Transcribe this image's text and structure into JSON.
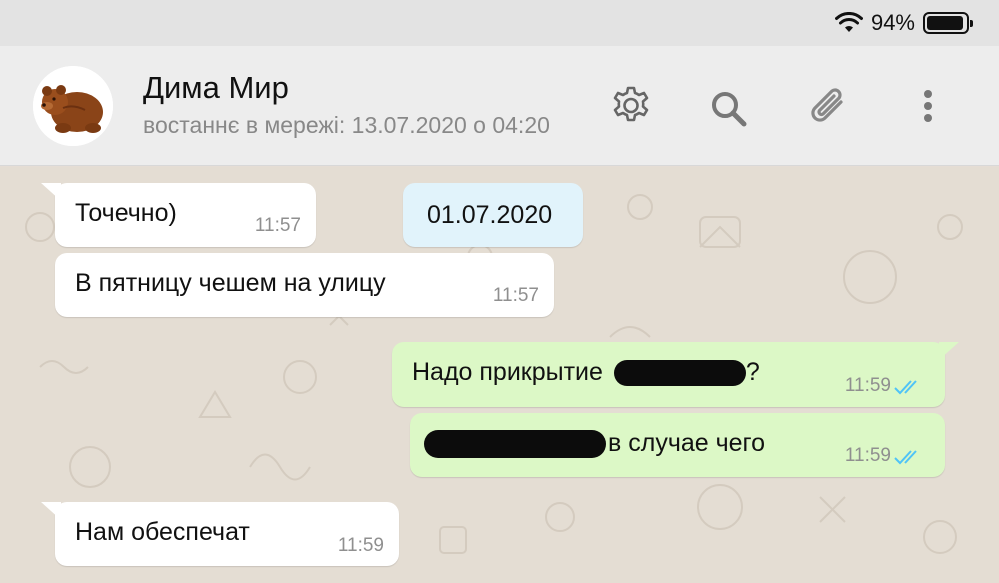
{
  "status_bar": {
    "battery": "94%",
    "battery_level": 0.94
  },
  "header": {
    "contact_name": "Дима Мир",
    "contact_status": "востаннє в мережі: 13.07.2020 о 04:20",
    "icons": [
      "settings-gear-icon",
      "search-icon",
      "paperclip-icon",
      "more-vertical-icon"
    ]
  },
  "colors": {
    "incoming_bubble": "#ffffff",
    "outgoing_bubble": "#dcf8c6",
    "date_badge": "#e1f3fb",
    "chat_background": "#e4ddd3",
    "read_ticks": "#4fc3f7"
  },
  "messages": [
    {
      "direction": "in",
      "text": "Точечно)",
      "time": "11:57"
    },
    {
      "direction": "in",
      "text": "В пятницу чешем на улицу",
      "time": "11:57"
    },
    {
      "direction": "out",
      "text_before": "Надо прикрытие",
      "text_after": "?",
      "time": "11:59",
      "status": "read"
    },
    {
      "direction": "out",
      "text_before": "",
      "text_after": "в случае чего",
      "time": "11:59",
      "status": "read"
    },
    {
      "direction": "in",
      "text": "Нам обеспечат",
      "time": "11:59"
    }
  ],
  "date_badge": "01.07.2020"
}
